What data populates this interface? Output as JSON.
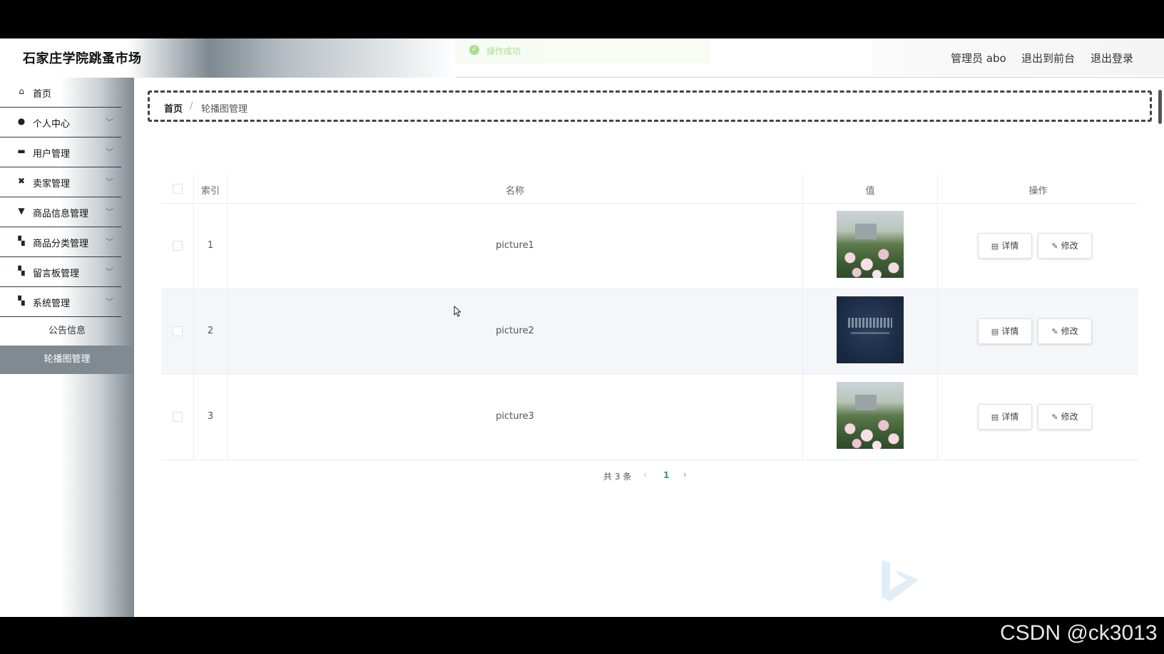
{
  "header": {
    "app_title": "石家庄学院跳蚤市场",
    "toast_text": "操作成功",
    "admin_label": "管理员 abo",
    "to_front_label": "退出到前台",
    "logout_label": "退出登录"
  },
  "sidebar": {
    "items": [
      {
        "label": "首页",
        "icon": "home-icon"
      },
      {
        "label": "个人中心",
        "icon": "user-icon"
      },
      {
        "label": "用户管理",
        "icon": "briefcase-icon"
      },
      {
        "label": "卖家管理",
        "icon": "ticket-icon"
      },
      {
        "label": "商品信息管理",
        "icon": "pin-icon"
      },
      {
        "label": "商品分类管理",
        "icon": "grid-icon"
      },
      {
        "label": "留言板管理",
        "icon": "grid-icon"
      },
      {
        "label": "系统管理",
        "icon": "grid-icon"
      }
    ],
    "sub_items": [
      {
        "label": "公告信息"
      },
      {
        "label": "轮播图管理"
      }
    ]
  },
  "breadcrumb": {
    "home": "首页",
    "separator": "/",
    "current": "轮播图管理"
  },
  "table": {
    "columns": [
      "索引",
      "名称",
      "值",
      "操作"
    ],
    "rows": [
      {
        "index": "1",
        "name": "picture1",
        "value_image": "campus-flowers"
      },
      {
        "index": "2",
        "name": "picture2",
        "value_image": "dark-sign"
      },
      {
        "index": "3",
        "name": "picture3",
        "value_image": "campus-flowers"
      }
    ],
    "detail_label": "详情",
    "edit_label": "修改"
  },
  "pagination": {
    "total_text": "共 3 条",
    "current_page": "1"
  },
  "watermark_text": "CSDN @ck3013",
  "colors": {
    "active_menu_bg": "#7f8a91",
    "page_active": "#2b9a6a",
    "toast_green": "#67c23a"
  }
}
